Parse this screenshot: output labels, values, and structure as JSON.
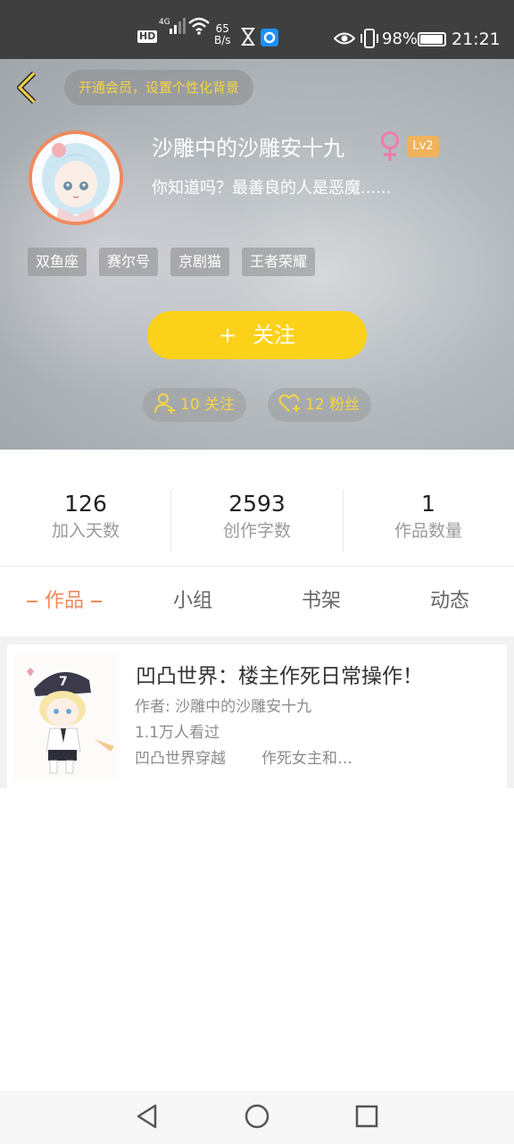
{
  "status_bar": {
    "hd": "HD",
    "network": "4G",
    "speed_value": "65",
    "speed_unit": "B/s",
    "battery": "98%",
    "time": "21:21"
  },
  "header": {
    "vip_prompt": "开通会员，设置个性化背景",
    "username": "沙雕中的沙雕安十九",
    "level": "Lv2",
    "bio": "你知道吗？最善良的人是恶魔......",
    "tags": [
      "双鱼座",
      "赛尔号",
      "京剧猫",
      "王者荣耀"
    ],
    "follow_button": "关注",
    "follow_plus": "+",
    "following_label": "10 关注",
    "fans_label": "12 粉丝"
  },
  "stats": [
    {
      "value": "126",
      "label": "加入天数"
    },
    {
      "value": "2593",
      "label": "创作字数"
    },
    {
      "value": "1",
      "label": "作品数量"
    }
  ],
  "tabs": [
    {
      "label": "作品",
      "active": true
    },
    {
      "label": "小组",
      "active": false
    },
    {
      "label": "书架",
      "active": false
    },
    {
      "label": "动态",
      "active": false
    }
  ],
  "works": [
    {
      "title": "凹凸世界：楼主作死日常操作！",
      "author": "作者: 沙雕中的沙雕安十九",
      "views": "1.1万人看过",
      "tags": [
        "凹凸世界穿越",
        "作死女主和…"
      ]
    }
  ],
  "colors": {
    "accent_orange": "#f08a5d",
    "follow_yellow": "#fcd11a",
    "vip_text": "#f5d545",
    "female_pink": "#f07aa8",
    "level_badge": "#f0b35a"
  },
  "icons": {
    "back": "chevron-left-icon",
    "gender": "female-icon",
    "following": "user-plus-icon",
    "fans": "heart-plus-icon",
    "nav_back": "triangle-back-icon",
    "nav_home": "circle-home-icon",
    "nav_recent": "square-recent-icon"
  }
}
